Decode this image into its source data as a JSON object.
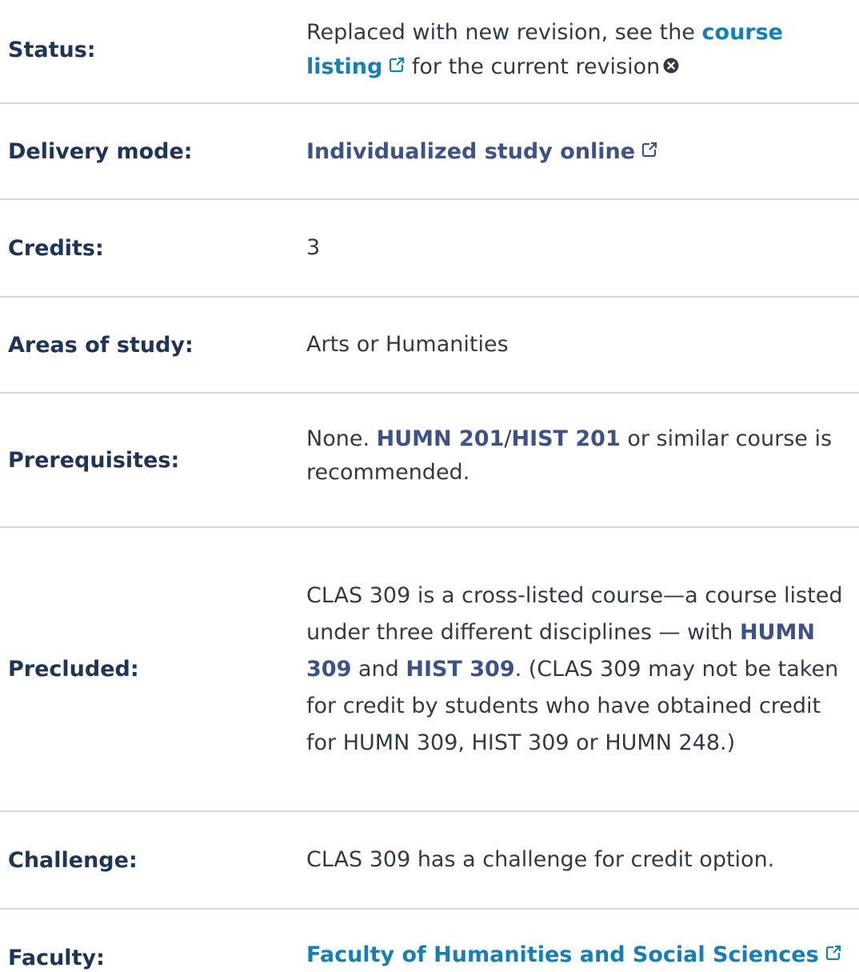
{
  "status": {
    "label": "Status:",
    "text_before": "Replaced with new revision, see the ",
    "link": "course listing",
    "text_after": " for the current revision"
  },
  "delivery": {
    "label": "Delivery mode:",
    "link": "Individualized study online"
  },
  "credits": {
    "label": "Credits:",
    "value": "3"
  },
  "areas": {
    "label": "Areas of study:",
    "value": "Arts or Humanities"
  },
  "prereq": {
    "label": "Prerequisites:",
    "text1": "None. ",
    "link1": "HUMN 201",
    "sep": "/",
    "link2": "HIST 201",
    "text2": " or similar course is recommended."
  },
  "precluded": {
    "label": "Precluded:",
    "text1": "CLAS 309 is a cross-listed course—a course listed under three different disciplines — with ",
    "link1": "HUMN 309",
    "text2": " and ",
    "link2": "HIST 309",
    "text3": ". (CLAS 309 may not be taken for credit by students who have obtained credit for HUMN 309, HIST 309 or HUMN 248.)"
  },
  "challenge": {
    "label": "Challenge:",
    "value": "CLAS 309 has a challenge for credit option."
  },
  "faculty": {
    "label": "Faculty:",
    "link": "Faculty of Humanities and Social Sciences"
  },
  "icons": {
    "external": "external-link-icon",
    "close": "close-circle-icon"
  },
  "colors": {
    "label": "#1f3557",
    "link_teal": "#177fb7",
    "link_navy": "#3e5189",
    "divider": "#d5d9e2",
    "text": "#333a44"
  }
}
